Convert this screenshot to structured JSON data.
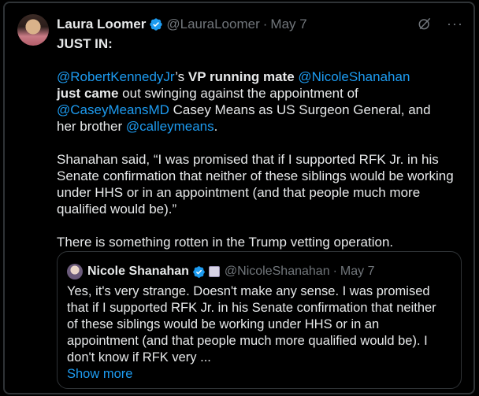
{
  "tweet": {
    "author_name": "Laura Loomer",
    "handle": "@LauraLoomer",
    "separator": "·",
    "date": "May 7",
    "more_label": "···",
    "line1": "JUST IN:",
    "p2": {
      "mention_rfk": "@RobertKennedyJr",
      "apos": "’s ",
      "bold1": "VP running mate",
      "space1": " ",
      "mention_nicole": "@NicoleShanahan",
      "bold2": "just came",
      "t1": " out swinging against the appointment of",
      "mention_casey": "@CaseyMeansMD",
      "t2": " Casey Means as US Surgeon General, and",
      "t3": "her brother ",
      "mention_calley": "@calleymeans",
      "t4": "."
    },
    "p3": "Shanahan said, “I was promised that if I supported RFK Jr. in his Senate confirmation that neither of these siblings would be working under HHS or in an appointment (and that people much more qualified would be).”",
    "p4": "There is something rotten in the Trump vetting operation."
  },
  "quote": {
    "author_name": "Nicole Shanahan",
    "handle": "@NicoleShanahan",
    "separator": "·",
    "date": "May 7",
    "text": "Yes, it's very strange. Doesn't make any sense. I was promised that if I supported RFK Jr. in his Senate confirmation that neither of these siblings would be working under HHS or in an appointment (and that people much more qualified would be). I don't know if RFK very ...",
    "show_more": "Show more"
  },
  "colors": {
    "background": "#000000",
    "text": "#e7e9ea",
    "secondary": "#71767b",
    "link": "#1d9bf0",
    "border": "#2f3336"
  },
  "icons": [
    "verified-badge-icon",
    "grok-icon",
    "more-icon",
    "affiliation-badge-icon"
  ]
}
